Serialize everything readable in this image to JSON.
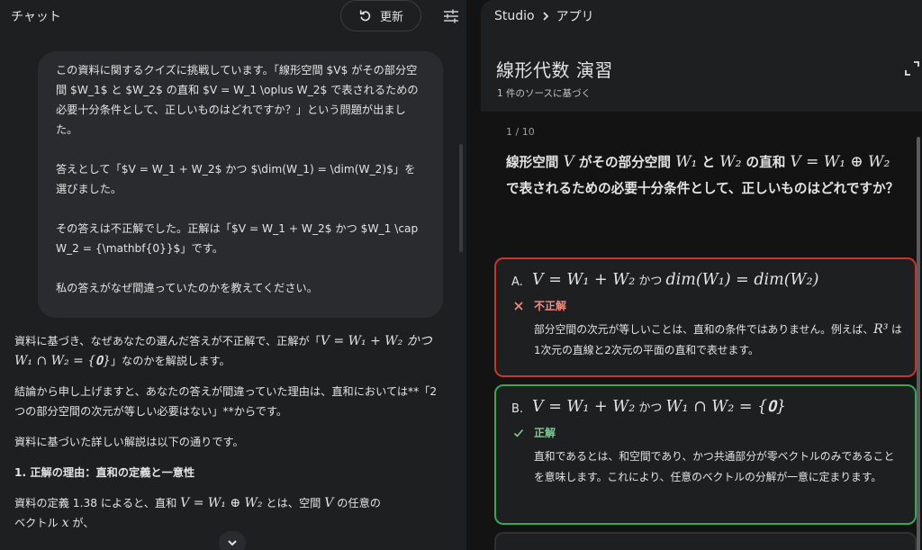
{
  "chat": {
    "title": "チャット",
    "refresh_label": "更新",
    "user_message": [
      "この資料に関するクイズに挑戦しています。「線形空間 $V$ がその部分空間 $W_1$ と $W_2$ の直和 $V = W_1 \\oplus W_2$ で表されるための必要十分条件として、正しいものはどれですか？」という問題が出ました。",
      "答えとして「$V = W_1 + W_2$ かつ $\\dim(W_1) = \\dim(W_2)$」を選びました。",
      "その答えは不正解でした。正解は「$V = W_1 + W_2$ かつ $W_1 \\cap W_2 = {\\mathbf{0}}$」です。",
      "私の答えがなぜ間違っていたのかを教えてください。"
    ],
    "response": {
      "p1_pre": "資料に基づき、なぜあなたの選んだ答えが不正解で、正解が「",
      "p1_math": "V = W₁ + W₂ かつ W₁ ∩ W₂ = {𝟎}",
      "p1_post": "」なのかを解説します。",
      "p2": "結論から申し上げますと、あなたの答えが間違っていた理由は、直和においては**「2つの部分空間の次元が等しい必要はない」**からです。",
      "p3": "資料に基づいた詳しい解説は以下の通りです。",
      "heading": "1. 正解の理由：直和の定義と一意性",
      "p4_a": "資料の定義 1.38 によると、直和 ",
      "p4_math1": "V = W₁ ⊕ W₂",
      "p4_b": " とは、空間 ",
      "p4_math2": "V",
      "p4_c": " の任意の",
      "p5_a": "ベクトル ",
      "p5_math": "x",
      "p5_b": " が、"
    }
  },
  "studio": {
    "breadcrumb_root": "Studio",
    "breadcrumb_current": "アプリ",
    "title": "線形代数 演習",
    "subtitle": "1 件のソースに基づく",
    "counter": "1 / 10",
    "question": {
      "a": "線形空間 ",
      "m1": "V",
      "b": " がその部分空間 ",
      "m2": "W₁",
      "c": " と ",
      "m3": "W₂",
      "d": " の直和 ",
      "m4": "V = W₁ ⊕ W₂",
      "e": "で表されるための必要十分条件として、正しいものはどれですか？"
    },
    "options": [
      {
        "letter": "A.",
        "math1": "V = W₁ + W₂",
        "joiner": " かつ ",
        "math2": "dim(W₁) = dim(W₂)",
        "verdict": "不正解",
        "explain_a": "部分空間の次元が等しいことは、直和の条件ではありません。例えば、",
        "explain_math": "R³",
        "explain_b": " は1次元の直線と2次元の平面の直和で表せます。"
      },
      {
        "letter": "B.",
        "math1": "V = W₁ + W₂",
        "joiner": " かつ ",
        "math2": "W₁ ∩ W₂ = {𝟎}",
        "verdict": "正解",
        "explain": "直和であるとは、和空間であり、かつ共通部分が零ベクトルのみであることを意味します。これにより、任意のベクトルの分解が一意に定まります。"
      }
    ]
  },
  "colors": {
    "wrong_border": "#c5362f",
    "right_border": "#3aa457",
    "wrong_text": "#f28b82",
    "right_text": "#81c995"
  },
  "icons": [
    "refresh-icon",
    "tune-icon",
    "chevron-right-icon",
    "expand-icon",
    "close-icon",
    "check-icon",
    "chevron-down-icon"
  ]
}
